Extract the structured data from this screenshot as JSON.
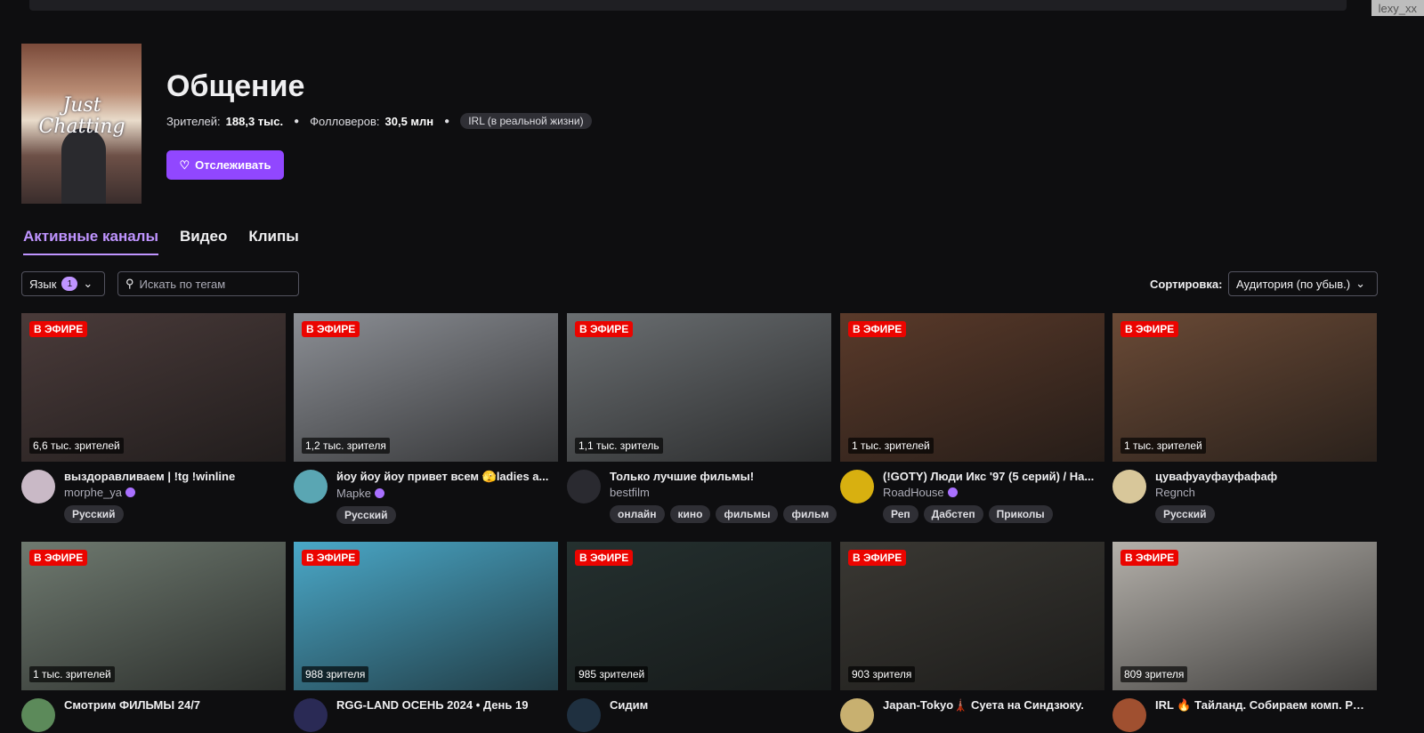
{
  "watermark": "lexy_xx",
  "category": {
    "title": "Общение",
    "cover_text": "Just Chatting",
    "viewers_label": "Зрителей:",
    "viewers": "188,3 тыс.",
    "followers_label": "Фолловеров:",
    "followers": "30,5 млн",
    "tag": "IRL (в реальной жизни)",
    "follow_label": "Отслеживать"
  },
  "tabs": [
    "Активные каналы",
    "Видео",
    "Клипы"
  ],
  "filters": {
    "language_label": "Язык",
    "language_count": "1",
    "search_placeholder": "Искать по тегам",
    "sort_label": "Сортировка:",
    "sort_value": "Аудитория (по убыв.)"
  },
  "live_label": "В ЭФИРЕ",
  "streams": [
    {
      "views": "6,6 тыс. зрителей",
      "title": "выздоравливаем | !tg !winline",
      "channel": "morphe_ya",
      "verified": true,
      "tags": [
        "Русский"
      ],
      "thumb": "#4a3b3a",
      "av": "#c9b9c6"
    },
    {
      "views": "1,2 тыс. зрителя",
      "title": "йоу йоу йоу привет всем 🫣ladies a...",
      "channel": "Mapke",
      "verified": true,
      "tags": [
        "Русский"
      ],
      "thumb": "#8c8f95",
      "av": "#5aa6b3"
    },
    {
      "views": "1,1 тыс. зритель",
      "title": "Только лучшие фильмы!",
      "channel": "bestfilm",
      "verified": false,
      "tags": [
        "онлайн",
        "кино",
        "фильмы",
        "фильм"
      ],
      "thumb": "#6b6f72",
      "av": "#2a2a30"
    },
    {
      "views": "1 тыс. зрителей",
      "title": "(!GOTY) Люди Икс '97 (5 серий) / На...",
      "channel": "RoadHouse",
      "verified": true,
      "tags": [
        "Реп",
        "Дабстеп",
        "Приколы"
      ],
      "thumb": "#5a3a2a",
      "av": "#d8b010"
    },
    {
      "views": "1 тыс. зрителей",
      "title": "цувафуауфауфафаф",
      "channel": "Regnch",
      "verified": false,
      "tags": [
        "Русский"
      ],
      "thumb": "#6a4a36",
      "av": "#d8c79a"
    },
    {
      "views": "1 тыс. зрителей",
      "title": "Смотрим ФИЛЬМЫ 24/7",
      "thumb": "#6f7a70",
      "av": "#5c8a5a"
    },
    {
      "views": "988 зрителя",
      "title": "RGG-LAND ОСЕНЬ 2024 • День 19",
      "thumb": "#4aa8c8",
      "av": "#2a2a55"
    },
    {
      "views": "985 зрителей",
      "title": "Сидим",
      "thumb": "#24302f",
      "av": "#1f3040"
    },
    {
      "views": "903 зрителя",
      "title": "Japan-Tokyo🗼 Суета на Синдзюку.",
      "thumb": "#3a3833",
      "av": "#c8b070"
    },
    {
      "views": "809 зрителя",
      "title": "IRL 🔥 Тайланд. Собираем комп. Раз...",
      "thumb": "#b4b0aa",
      "av": "#a05030"
    }
  ]
}
